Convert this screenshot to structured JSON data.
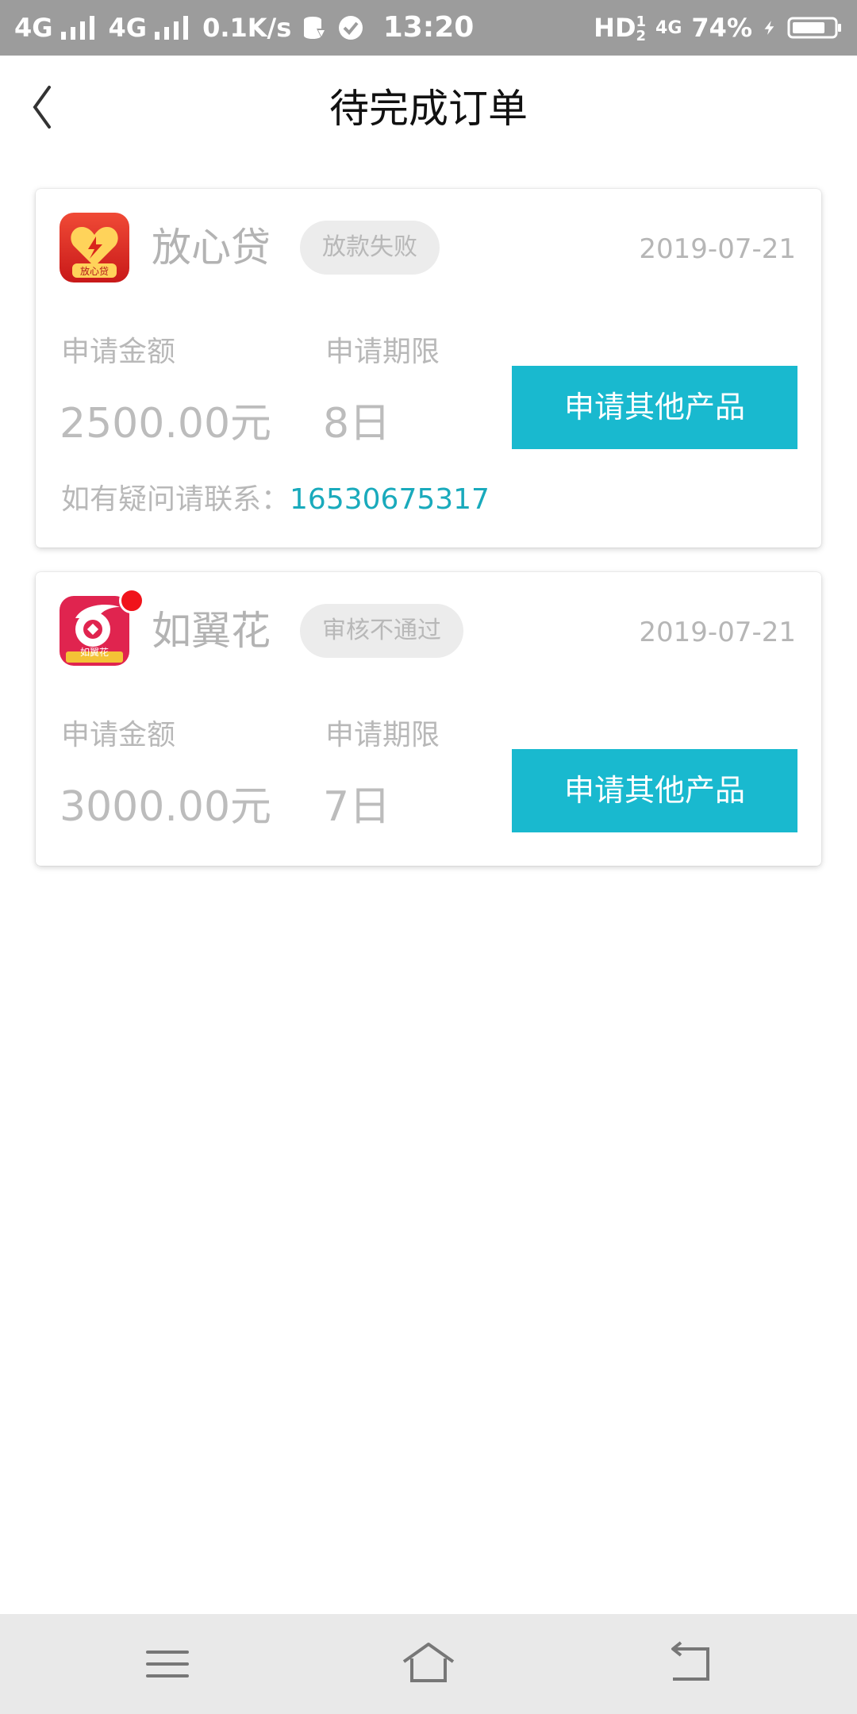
{
  "status_bar": {
    "signal1": "4G",
    "signal2": "4G",
    "speed": "0.1K/s",
    "time": "13:20",
    "hd": "HD",
    "hd_sup": "1",
    "hd_sub": "2",
    "network": "4G",
    "battery": "74%",
    "icons": [
      "signal-bars-icon",
      "data-usage-icon",
      "check-circle-icon",
      "charging-icon",
      "battery-icon"
    ]
  },
  "header": {
    "title": "待完成订单",
    "back_icon": "chevron-left-icon"
  },
  "orders": [
    {
      "name": "放心贷",
      "logo_text": "放心贷",
      "status": "放款失败",
      "date": "2019-07-21",
      "amount_label": "申请金额",
      "amount": "2500.00元",
      "term_label": "申请期限",
      "term": "8日",
      "button": "申请其他产品",
      "contact_label": "如有疑问请联系：",
      "contact_phone": "16530675317"
    },
    {
      "name": "如翼花",
      "logo_text": "如翼花",
      "status": "审核不通过",
      "date": "2019-07-21",
      "amount_label": "申请金额",
      "amount": "3000.00元",
      "term_label": "申请期限",
      "term": "7日",
      "button": "申请其他产品"
    }
  ],
  "nav_bar": {
    "icons": [
      "menu-icon",
      "home-icon",
      "back-icon"
    ]
  },
  "colors": {
    "accent": "#19b9cf",
    "phone_link": "#19aabc",
    "status_bar": "#9c9c9c",
    "badge": "#f0131b"
  }
}
